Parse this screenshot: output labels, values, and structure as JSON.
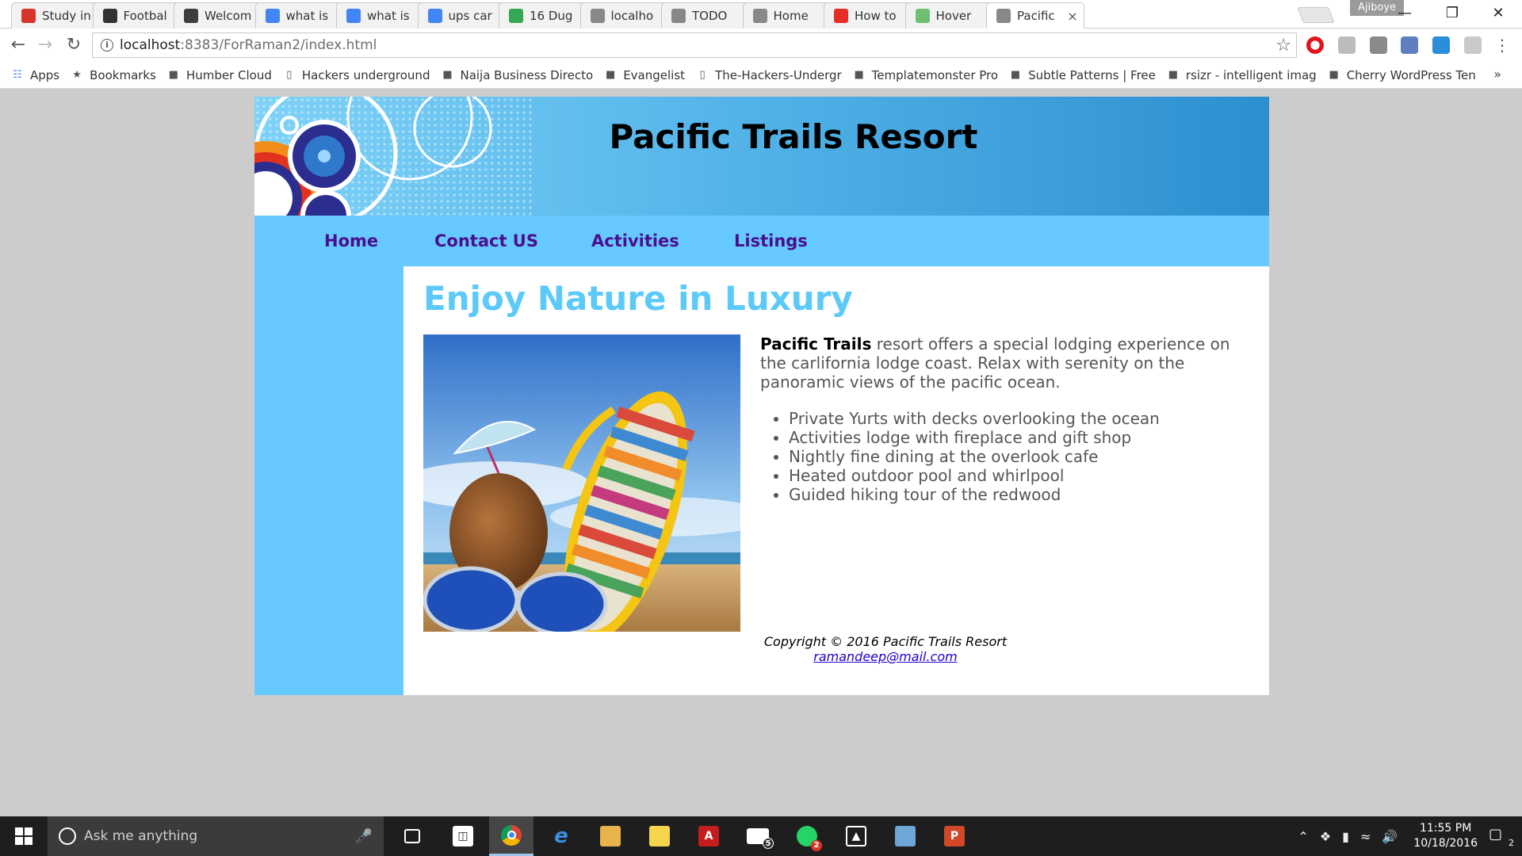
{
  "browser": {
    "tabs": [
      {
        "label": "Study in",
        "icon": "maple-leaf-icon",
        "color": "#d9342b"
      },
      {
        "label": "Footbal",
        "icon": "football-site-icon",
        "color": "#333333"
      },
      {
        "label": "Welcom",
        "icon": "be-site-icon",
        "color": "#3d3d3d"
      },
      {
        "label": "what is",
        "icon": "google-icon",
        "color": "#4285f4"
      },
      {
        "label": "what is",
        "icon": "google-icon",
        "color": "#4285f4"
      },
      {
        "label": "ups car",
        "icon": "google-icon",
        "color": "#4285f4"
      },
      {
        "label": "16 Dug",
        "icon": "google-maps-icon",
        "color": "#34a853"
      },
      {
        "label": "localho",
        "icon": "page-icon",
        "color": "#888888"
      },
      {
        "label": "TODO",
        "icon": "page-icon",
        "color": "#888888"
      },
      {
        "label": "Home",
        "icon": "page-icon",
        "color": "#888888"
      },
      {
        "label": "How to",
        "icon": "youtube-icon",
        "color": "#e52d27"
      },
      {
        "label": "Hover",
        "icon": "hex-site-icon",
        "color": "#6fbf73"
      },
      {
        "label": "Pacific",
        "icon": "page-icon",
        "color": "#888888"
      }
    ],
    "profile_name": "Ajiboye",
    "url_host": "localhost",
    "url_path": ":8383/ForRaman2/index.html",
    "bookmarks": [
      {
        "label": "Apps",
        "icon": "apps-grid-icon"
      },
      {
        "label": "Bookmarks",
        "icon": "star-icon"
      },
      {
        "label": "Humber Cloud",
        "icon": "humber-icon"
      },
      {
        "label": "Hackers underground",
        "icon": "page-icon"
      },
      {
        "label": "Naija Business Directo",
        "icon": "directory-icon"
      },
      {
        "label": "Evangelist",
        "icon": "book-icon"
      },
      {
        "label": "The-Hackers-Undergr",
        "icon": "page-icon"
      },
      {
        "label": "Templatemonster Pro",
        "icon": "templatemonster-icon"
      },
      {
        "label": "Subtle Patterns | Free",
        "icon": "subtle-patterns-icon"
      },
      {
        "label": "rsizr - intelligent imag",
        "icon": "rsizr-icon"
      },
      {
        "label": "Cherry WordPress Ten",
        "icon": "cherry-icon"
      }
    ]
  },
  "page": {
    "site_title": "Pacific Trails Resort",
    "nav": [
      "Home",
      "Contact US",
      "Activities",
      "Listings"
    ],
    "heading": "Enjoy Nature in Luxury",
    "intro_bold": "Pacific Trails",
    "intro_rest": " resort offers a special lodging experience on the carlifornia lodge coast. Relax with serenity on the panoramic views of the pacific ocean.",
    "features": [
      "Private Yurts with decks overlooking the ocean",
      "Activities lodge with fireplace and gift shop",
      "Nightly fine dining at the overlook cafe",
      "Heated outdoor pool and whirlpool",
      "Guided hiking tour of the redwood"
    ],
    "copyright": "Copyright © 2016 Pacific Trails Resort",
    "email": "ramandeep@mail.com"
  },
  "taskbar": {
    "search_placeholder": "Ask me anything",
    "apps": [
      {
        "name": "task-view",
        "color": "#1e1e1e"
      },
      {
        "name": "store",
        "color": "#1e1e1e"
      },
      {
        "name": "chrome",
        "color": "#1e1e1e"
      },
      {
        "name": "edge",
        "color": "#1e1e1e"
      },
      {
        "name": "file-explorer",
        "color": "#e8b34b"
      },
      {
        "name": "sticky-notes",
        "color": "#f7d54b"
      },
      {
        "name": "acrobat",
        "color": "#c51d1d"
      },
      {
        "name": "mail",
        "color": "#1e1e1e"
      },
      {
        "name": "whatsapp",
        "color": "#25d366"
      },
      {
        "name": "photos",
        "color": "#1e1e1e"
      },
      {
        "name": "virtualbox",
        "color": "#6ea6d8"
      },
      {
        "name": "powerpoint",
        "color": "#d24726"
      }
    ],
    "mail_badge": "5",
    "whatsapp_badge": "2",
    "time": "11:55 PM",
    "date": "10/18/2016",
    "notifications": "2"
  }
}
